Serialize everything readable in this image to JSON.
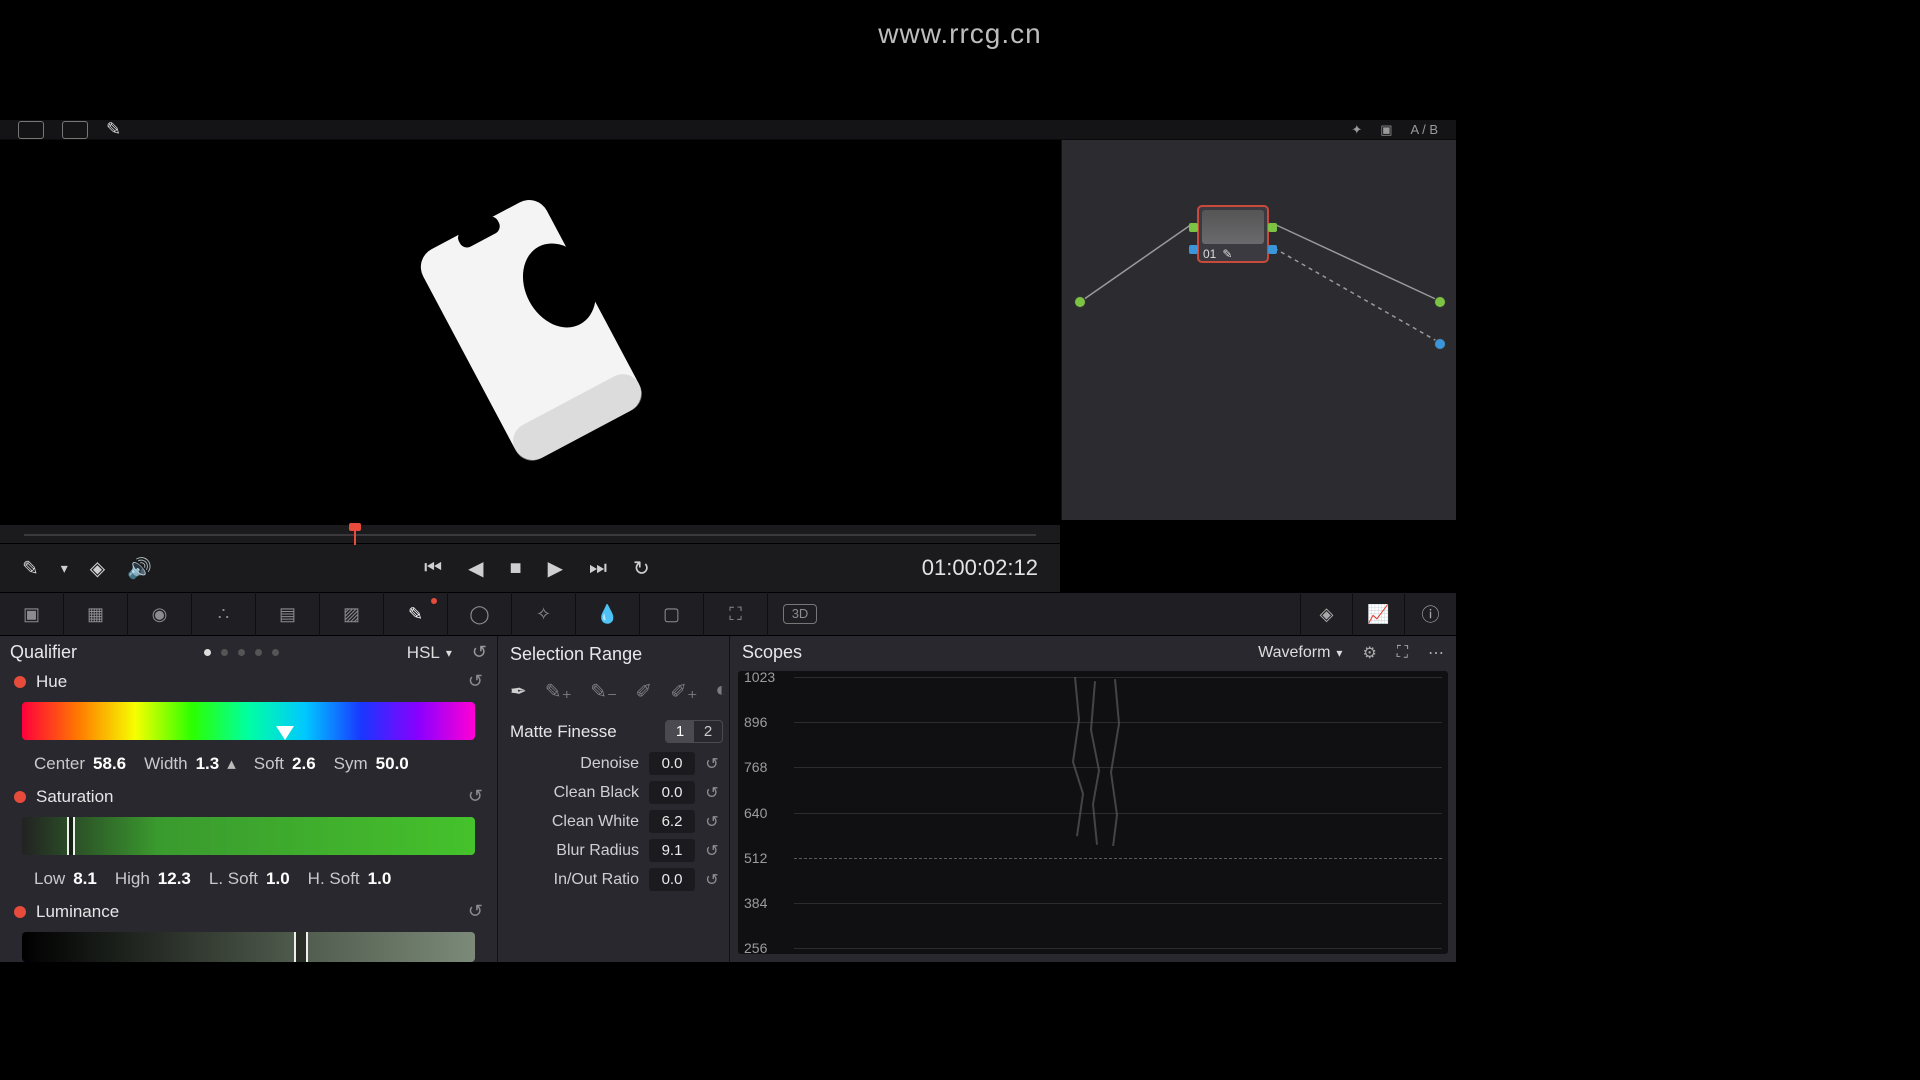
{
  "watermark_top": "www.rrcg.cn",
  "topbar": {
    "ab_label": "A / B"
  },
  "viewer": {
    "timecode": "01:00:02:12"
  },
  "node": {
    "label": "01"
  },
  "palette": {
    "stereo_label": "3D"
  },
  "qualifier": {
    "title": "Qualifier",
    "mode": "HSL",
    "hue": {
      "label": "Hue",
      "center_label": "Center",
      "center_value": "58.6",
      "width_label": "Width",
      "width_value": "1.3",
      "soft_label": "Soft",
      "soft_value": "2.6",
      "sym_label": "Sym",
      "sym_value": "50.0"
    },
    "saturation": {
      "label": "Saturation",
      "low_label": "Low",
      "low_value": "8.1",
      "high_label": "High",
      "high_value": "12.3",
      "lsoft_label": "L. Soft",
      "lsoft_value": "1.0",
      "hsoft_label": "H. Soft",
      "hsoft_value": "1.0"
    },
    "luminance": {
      "label": "Luminance"
    }
  },
  "selection": {
    "title": "Selection Range",
    "matte_label": "Matte Finesse",
    "tab1": "1",
    "tab2": "2",
    "rows": [
      {
        "label": "Denoise",
        "value": "0.0"
      },
      {
        "label": "Clean Black",
        "value": "0.0"
      },
      {
        "label": "Clean White",
        "value": "6.2"
      },
      {
        "label": "Blur Radius",
        "value": "9.1"
      },
      {
        "label": "In/Out Ratio",
        "value": "0.0"
      }
    ]
  },
  "scopes": {
    "title": "Scopes",
    "mode": "Waveform",
    "ticks": [
      "1023",
      "896",
      "768",
      "640",
      "512",
      "384",
      "256"
    ]
  }
}
